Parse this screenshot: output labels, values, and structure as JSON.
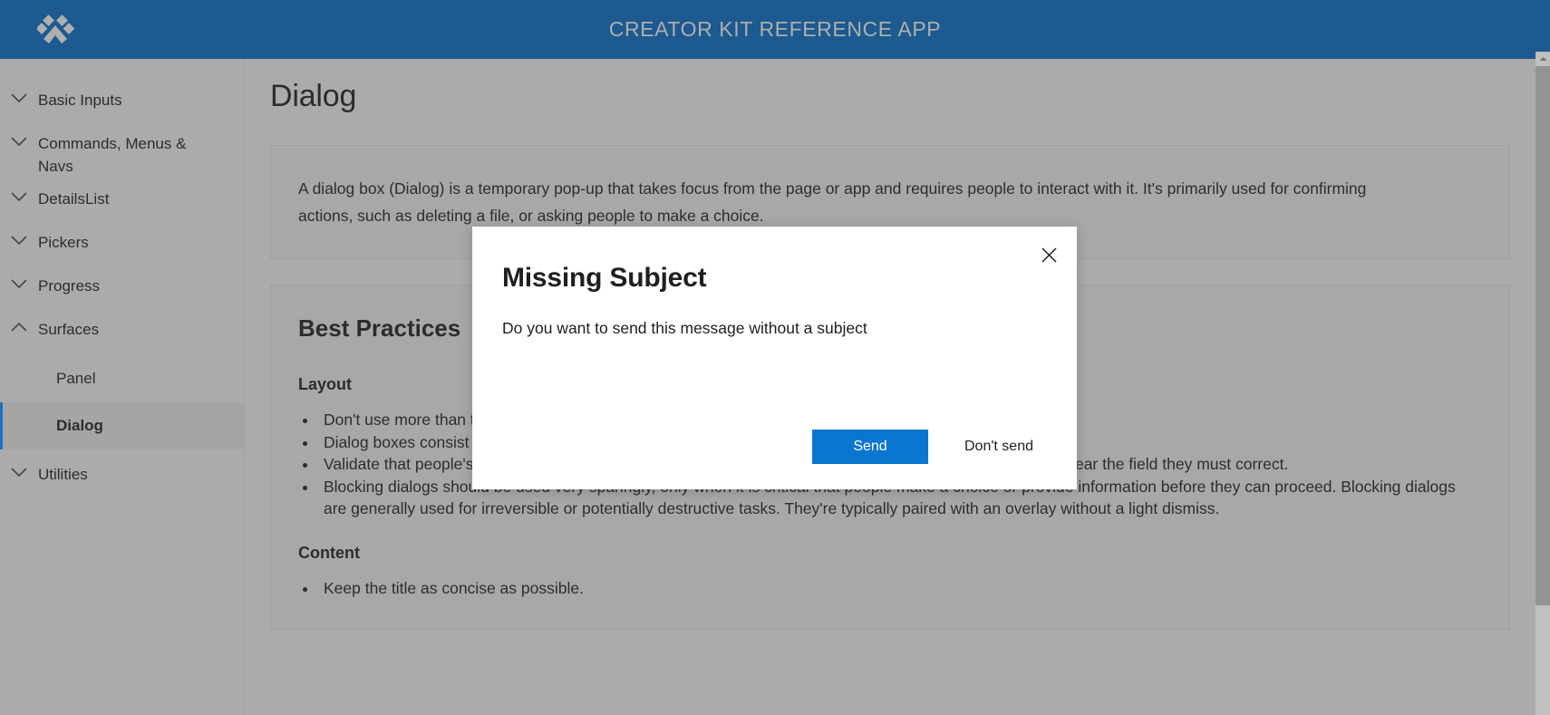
{
  "header": {
    "title": "CREATOR KIT REFERENCE APP",
    "logo_icon": "paw-logo-icon",
    "background_color": "#0e5089",
    "title_color": "#a9aaab"
  },
  "sidebar": {
    "groups": [
      {
        "label": "Basic Inputs",
        "icon": "chevron-down-icon",
        "expanded": false
      },
      {
        "label": "Commands, Menus & Navs",
        "icon": "chevron-down-icon",
        "expanded": false
      },
      {
        "label": "DetailsList",
        "icon": "chevron-down-icon",
        "expanded": false
      },
      {
        "label": "Pickers",
        "icon": "chevron-down-icon",
        "expanded": false
      },
      {
        "label": "Progress",
        "icon": "chevron-down-icon",
        "expanded": false
      },
      {
        "label": "Surfaces",
        "icon": "chevron-up-icon",
        "expanded": true
      },
      {
        "label": "Utilities",
        "icon": "chevron-down-icon",
        "expanded": false
      }
    ],
    "surfaces_children": [
      {
        "label": "Panel",
        "selected": false
      },
      {
        "label": "Dialog",
        "selected": true
      }
    ],
    "selected_accent_color": "#0b6cbe"
  },
  "main": {
    "page_title": "Dialog",
    "intro": "A dialog box (Dialog) is a temporary pop-up that takes focus from the page or app and requires people to interact with it. It's primarily used for confirming actions, such as deleting a file, or asking people to make a choice.",
    "best_practices_title": "Best Practices",
    "layout_title": "Layout",
    "layout_bullets": [
      "Don't use more than three buttons.",
      "Dialog boxes consist of a header, body, and footer.",
      "Validate that people's entries are acceptable before closing the dialog box. Show an inline validation error near the field they must correct.",
      "Blocking dialogs should be used very sparingly, only when it is critical that people make a choice or provide information before they can proceed. Blocking dialogs are generally used for irreversible or potentially destructive tasks. They're typically paired with an overlay without a light dismiss."
    ],
    "content_title": "Content",
    "content_bullets": [
      "Keep the title as concise as possible."
    ]
  },
  "modal": {
    "title": "Missing Subject",
    "subtext": "Do you want to send this message without a subject",
    "close_icon": "close-icon",
    "primary_button": "Send",
    "secondary_button": "Don't send",
    "primary_color": "#0b76d0"
  },
  "scrollbar": {
    "up_arrow_icon": "caret-up-icon"
  }
}
